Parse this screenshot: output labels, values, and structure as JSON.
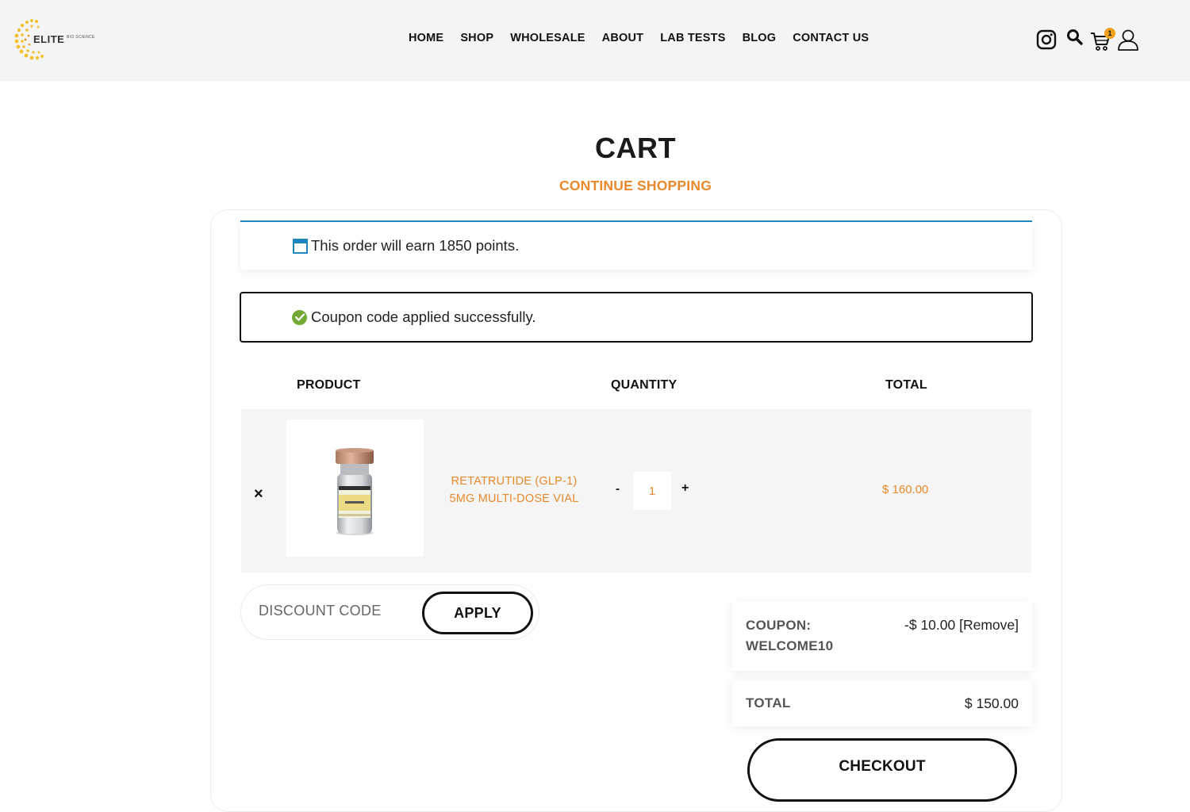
{
  "brand": {
    "logo_main": "ELITE",
    "logo_sub": "BIO SCIENCE"
  },
  "nav": {
    "items": [
      "HOME",
      "SHOP",
      "WHOLESALE",
      "ABOUT",
      "LAB TESTS",
      "BLOG",
      "CONTACT US"
    ]
  },
  "header_icons": {
    "instagram": "instagram-icon",
    "search": "search-icon",
    "cart": "cart-icon",
    "cart_count": "1",
    "account": "user-icon"
  },
  "page": {
    "title": "CART",
    "continue_link": "CONTINUE SHOPPING"
  },
  "notices": {
    "points": "This order will earn 1850 points.",
    "coupon_success": "Coupon code applied successfully."
  },
  "table": {
    "headers": {
      "product": "PRODUCT",
      "quantity": "QUANTITY",
      "total": "TOTAL"
    },
    "rows": [
      {
        "remove": "×",
        "name_line1": "RETATRUTIDE (GLP-1)",
        "name_line2": "5MG MULTI-DOSE VIAL",
        "qty_minus": "-",
        "quantity": "1",
        "qty_plus": "+",
        "total": "$ 160.00"
      }
    ]
  },
  "discount": {
    "placeholder": "DISCOUNT CODE",
    "apply_label": "APPLY"
  },
  "summary": {
    "coupon_label_1": "COUPON:",
    "coupon_label_2": "WELCOME10",
    "coupon_value": "-$ 10.00",
    "coupon_remove": "[Remove]",
    "total_label": "TOTAL",
    "total_value": "$ 150.00"
  },
  "checkout_label": "CHECKOUT",
  "colors": {
    "accent": "#e8892b",
    "info": "#1e85be",
    "success": "#74a935",
    "badge": "#f0a11d"
  }
}
